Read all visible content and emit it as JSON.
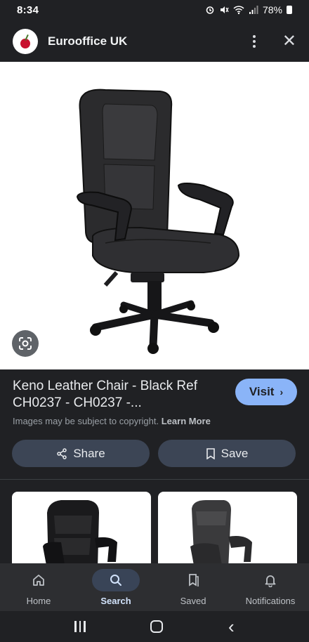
{
  "status_bar": {
    "time": "8:34",
    "icons": [
      "alarm-icon",
      "mute-icon",
      "wifi-icon",
      "signal-icon"
    ],
    "battery": "78%"
  },
  "header": {
    "site_name": "Eurooffice UK",
    "logo": "cherry-logo-icon"
  },
  "product": {
    "title": "Keno Leather Chair - Black Ref CH0237 - CH0237 -...",
    "visit_label": "Visit",
    "copyright_text": "Images may be subject to copyright.",
    "learn_more": "Learn More"
  },
  "actions": {
    "share_label": "Share",
    "save_label": "Save"
  },
  "bottom_nav": {
    "items": [
      {
        "label": "Home",
        "icon": "home-icon"
      },
      {
        "label": "Search",
        "icon": "search-icon",
        "active": true
      },
      {
        "label": "Saved",
        "icon": "saved-icon"
      },
      {
        "label": "Notifications",
        "icon": "bell-icon"
      }
    ]
  },
  "colors": {
    "background": "#202124",
    "accent": "#8ab4f8",
    "chip": "#3c4555"
  }
}
